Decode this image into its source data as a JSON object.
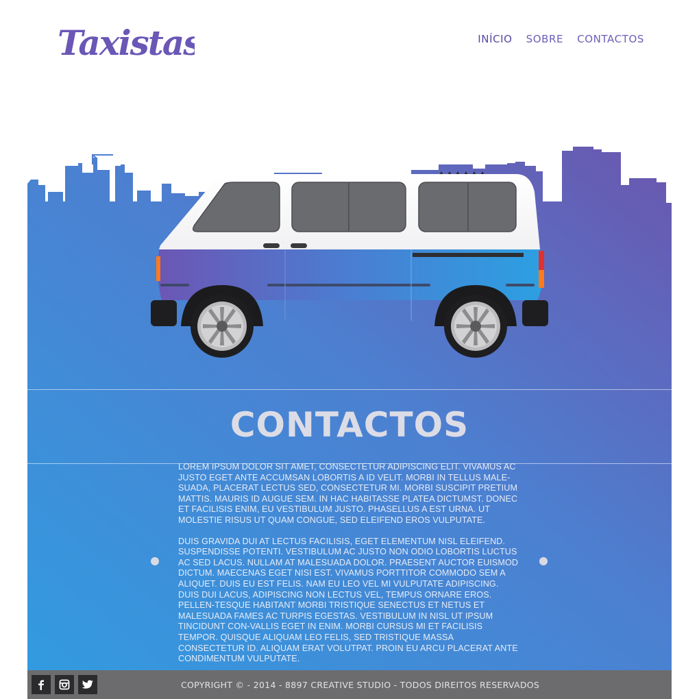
{
  "header": {
    "logo_text": "Taxistas",
    "nav": [
      {
        "label": "INÍCIO",
        "active": true
      },
      {
        "label": "SOBRE",
        "active": false
      },
      {
        "label": "CONTACTOS",
        "active": false
      }
    ]
  },
  "hero": {
    "gradient_start": "#3a9be0",
    "gradient_end": "#6a58b0",
    "van_body_color": "#3a8fd8",
    "van_roof_color": "#ffffff"
  },
  "section": {
    "title": "CONTACTOS",
    "paragraphs": [
      "Lorem ipsum dolor sit amet, consectetur adipiscing elit. Vivamus ac justo eget ante accumsan lobortis a id velit. Morbi in tellus male-suada, placerat lectus sed, consectetur mi. Morbi suscipit pretium mattis. Mauris id augue sem. In hac habitasse platea dictumst. Donec et facilisis enim, eu vestibulum justo. Phasellus a est urna. Ut molestie risus ut quam congue, sed eleifend eros vulputate.",
      "Duis gravida dui at lectus facilisis, eget elementum nisl eleifend. Suspendisse potenti. Vestibulum ac justo non odio lobortis luctus ac sed lacus. Nullam at malesuada dolor. Praesent auctor euismod dictum. Maecenas eget nisi est. Vivamus porttitor commodo sem a aliquet. Duis eu est felis. Nam eu leo vel mi vulputate adipiscing. Duis dui lacus, adipiscing non lectus vel, tempus ornare eros. Pellen-tesque habitant morbi tristique senectus et netus et malesuada fames ac turpis egestas. Vestibulum in nisl ut ipsum tincidunt con-vallis eget in enim. Morbi cursus mi et facilisis tempor. Quisque aliquam leo felis, sed tristique massa consectetur id. Aliquam erat volutpat. Proin eu arcu placerat ante condimentum vulputate."
    ]
  },
  "footer": {
    "social": [
      {
        "icon": "facebook-icon",
        "glyph": "f"
      },
      {
        "icon": "instagram-icon",
        "glyph": ""
      },
      {
        "icon": "twitter-icon",
        "glyph": ""
      }
    ],
    "copyright": "COPYRIGHT © - 2014 - 8897 CREATIVE STUDIO - TODOS DIREITOS RESERVADOS"
  }
}
